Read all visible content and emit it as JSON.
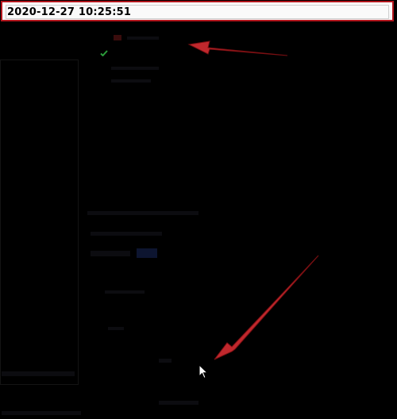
{
  "timestamp": {
    "value": "2020-12-27 10:25:51"
  },
  "annotations": {
    "arrow_color": "#c0282d",
    "arrows": [
      {
        "name": "upper-arrow",
        "points_to": "top menu item"
      },
      {
        "name": "lower-arrow",
        "points_to": "cursor location"
      }
    ]
  },
  "icons": {
    "check": "check-icon",
    "cursor": "mouse-pointer-icon"
  },
  "colors": {
    "background": "#000000",
    "highlight_border": "#b3161d",
    "check_green": "#2b9c3a",
    "selection_blue": "#1e3a8a"
  }
}
